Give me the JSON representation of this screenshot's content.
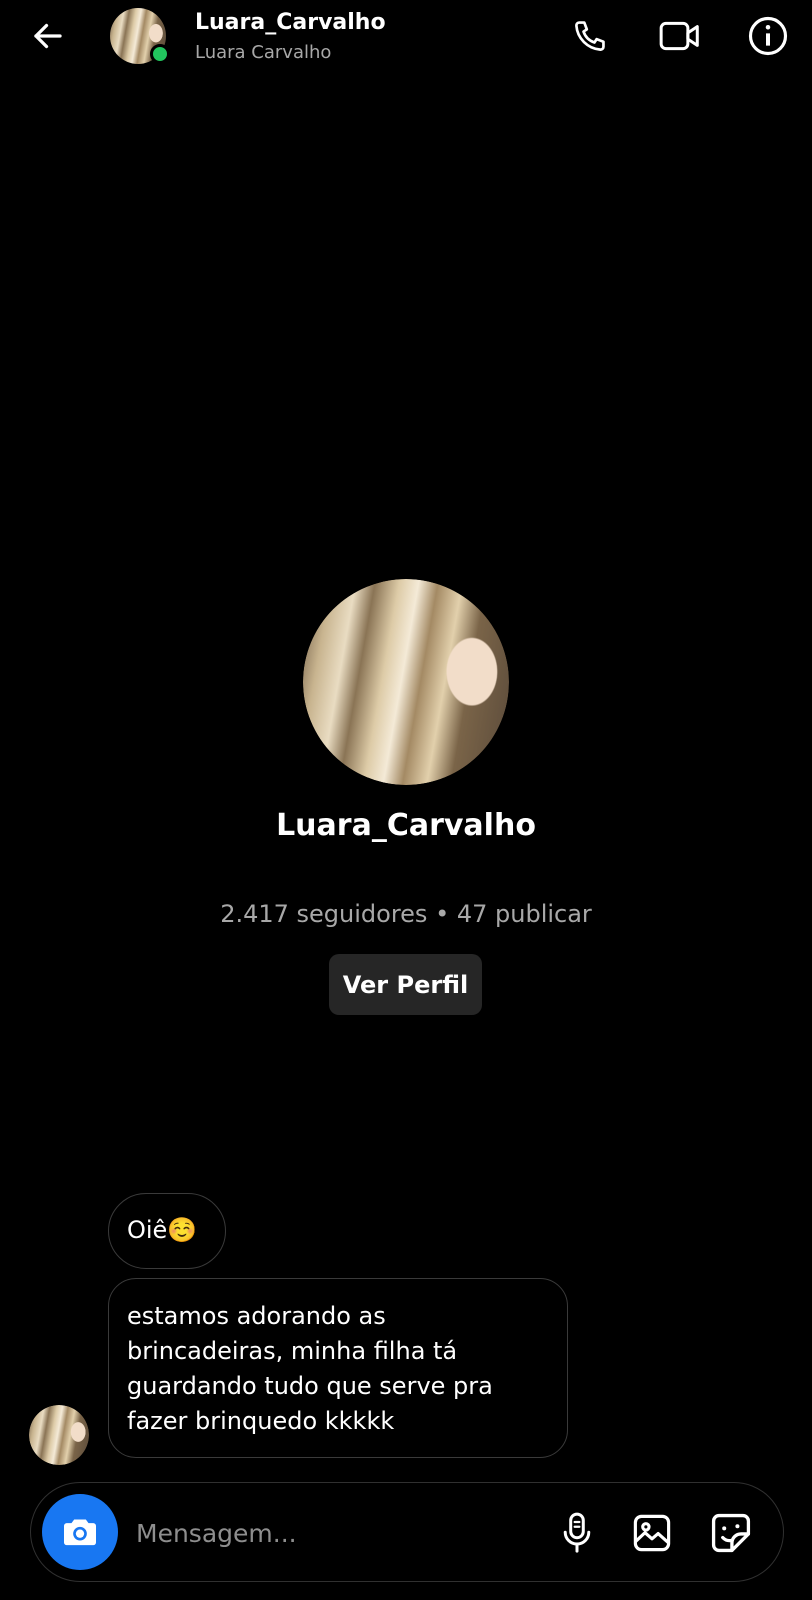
{
  "header": {
    "username": "Luara_Carvalho",
    "display_name": "Luara Carvalho",
    "online": true,
    "icons": [
      "back-arrow-icon",
      "phone-icon",
      "video-camera-icon",
      "info-icon"
    ]
  },
  "profile": {
    "username": "Luara_Carvalho",
    "stats": "2.417 seguidores • 47 publicar",
    "view_profile_label": "Ver Perfil"
  },
  "messages": [
    {
      "sender": "Luara_Carvalho",
      "text": "Oiê☺️"
    },
    {
      "sender": "Luara_Carvalho",
      "text": "estamos adorando as\nbrincadeiras, minha filha tá\nguardando tudo que serve pra\nfazer brinquedo kkkkk"
    }
  ],
  "composer": {
    "placeholder": "Mensagem...",
    "icons": [
      "camera-icon",
      "microphone-icon",
      "gallery-icon",
      "sticker-icon"
    ]
  },
  "colors": {
    "background": "#000000",
    "accent": "#1877f2",
    "online": "#22c55e",
    "button_bg": "#262626",
    "secondary_text": "#a8a8a8"
  }
}
